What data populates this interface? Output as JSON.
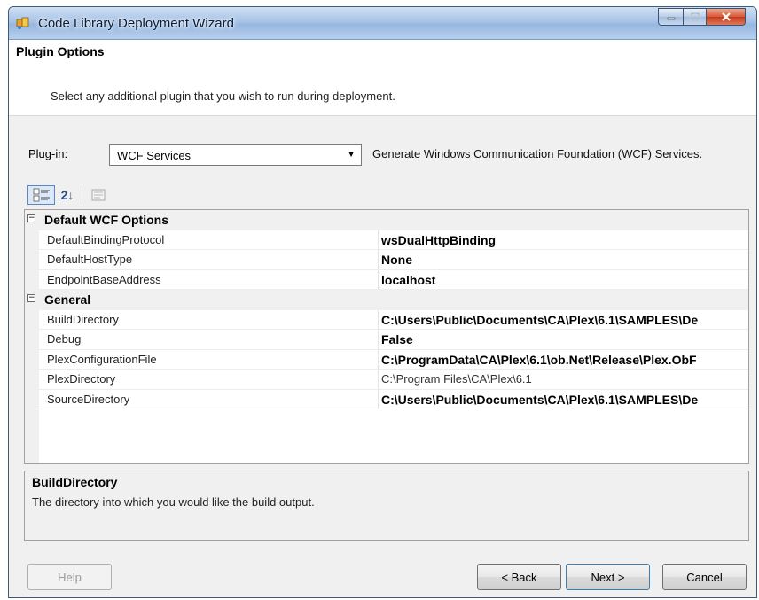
{
  "window": {
    "title": "Code Library Deployment Wizard",
    "accent": "#a7c3e6"
  },
  "header": {
    "title": "Plugin Options",
    "subtitle": "Select any additional plugin that you wish to run during deployment."
  },
  "plugin": {
    "label": "Plug-in:",
    "selected": "WCF Services",
    "description": "Generate Windows Communication Foundation (WCF) Services."
  },
  "toolbar": {
    "categorized_icon": "categorized-icon",
    "alphabetical_icon": "sort-alphabetical-icon",
    "alphabetical_glyph": "2↓",
    "property_pages_icon": "property-pages-icon"
  },
  "grid": {
    "categories": [
      {
        "name": "Default WCF Options",
        "expander": "⊟",
        "properties": [
          {
            "name": "DefaultBindingProtocol",
            "value": "wsDualHttpBinding",
            "bold": true
          },
          {
            "name": "DefaultHostType",
            "value": "None",
            "bold": true
          },
          {
            "name": "EndpointBaseAddress",
            "value": "localhost",
            "bold": true
          }
        ]
      },
      {
        "name": "General",
        "expander": "⊟",
        "properties": [
          {
            "name": "BuildDirectory",
            "value": "C:\\Users\\Public\\Documents\\CA\\Plex\\6.1\\SAMPLES\\De",
            "bold": true
          },
          {
            "name": "Debug",
            "value": "False",
            "bold": true
          },
          {
            "name": "PlexConfigurationFile",
            "value": "C:\\ProgramData\\CA\\Plex\\6.1\\ob.Net\\Release\\Plex.ObF",
            "bold": true
          },
          {
            "name": "PlexDirectory",
            "value": "C:\\Program Files\\CA\\Plex\\6.1",
            "bold": false
          },
          {
            "name": "SourceDirectory",
            "value": "C:\\Users\\Public\\Documents\\CA\\Plex\\6.1\\SAMPLES\\De",
            "bold": true
          }
        ]
      }
    ]
  },
  "help": {
    "title": "BuildDirectory",
    "description": "The directory into which you would like the build output."
  },
  "buttons": {
    "help": "Help",
    "back": "< Back",
    "next": "Next >",
    "cancel": "Cancel"
  }
}
